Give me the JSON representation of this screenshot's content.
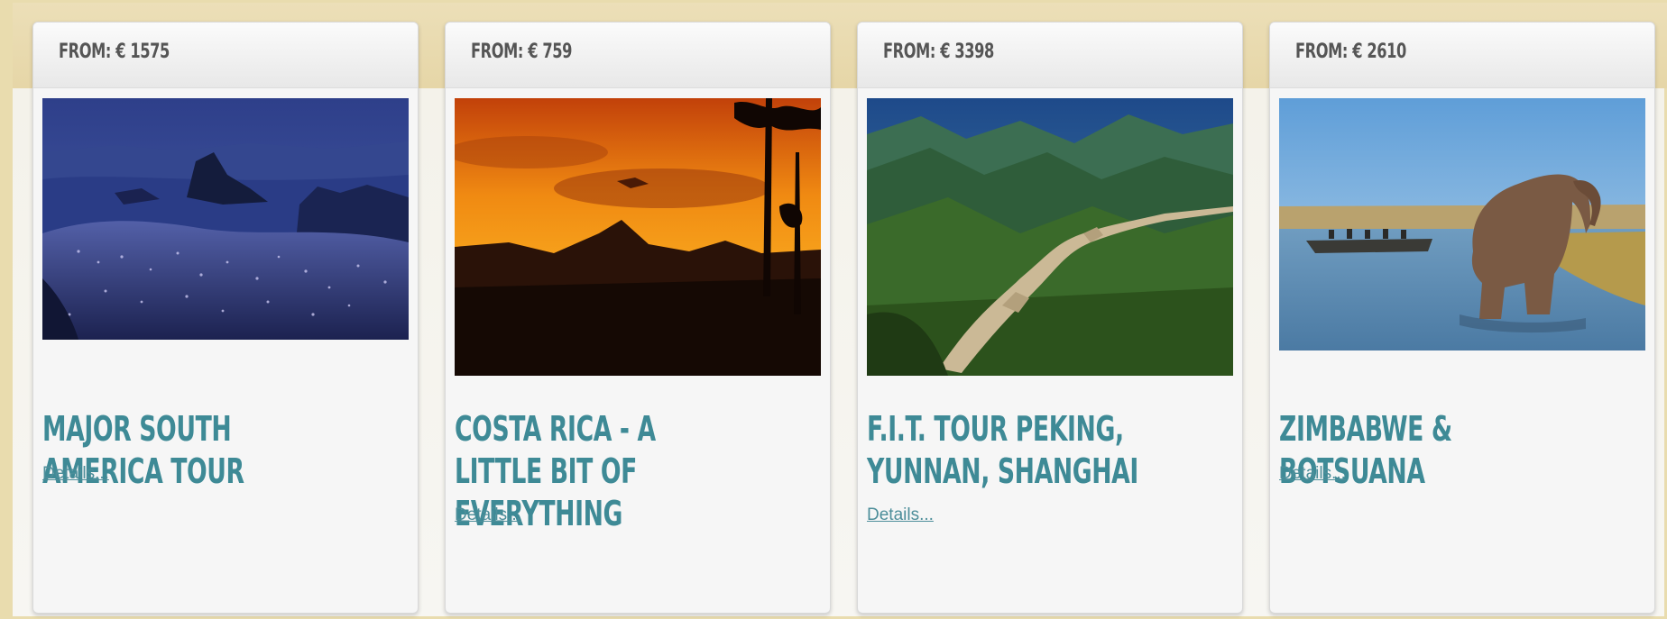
{
  "cards": [
    {
      "price": "FROM: € 1575",
      "title": "MAJOR SOUTH AMERICA TOUR",
      "link": "Details...",
      "image": "rio-de-janeiro-night-photo"
    },
    {
      "price": "FROM: € 759",
      "title": "COSTA RICA - A LITTLE BIT OF EVERYTHING",
      "link": "Details...",
      "image": "costa-rica-sunset-photo"
    },
    {
      "price": "FROM: € 3398",
      "title": "F.I.T. TOUR PEKING, YUNNAN, SHANGHAI",
      "link": "Details...",
      "image": "great-wall-photo"
    },
    {
      "price": "FROM: € 2610",
      "title": "ZIMBABWE & BOTSUANA",
      "link": "Details...",
      "image": "elephant-river-photo"
    }
  ],
  "colors": {
    "title": "#3e8a96",
    "link": "#4d8e9a",
    "price": "#555555",
    "frame": "#e9dcae"
  }
}
